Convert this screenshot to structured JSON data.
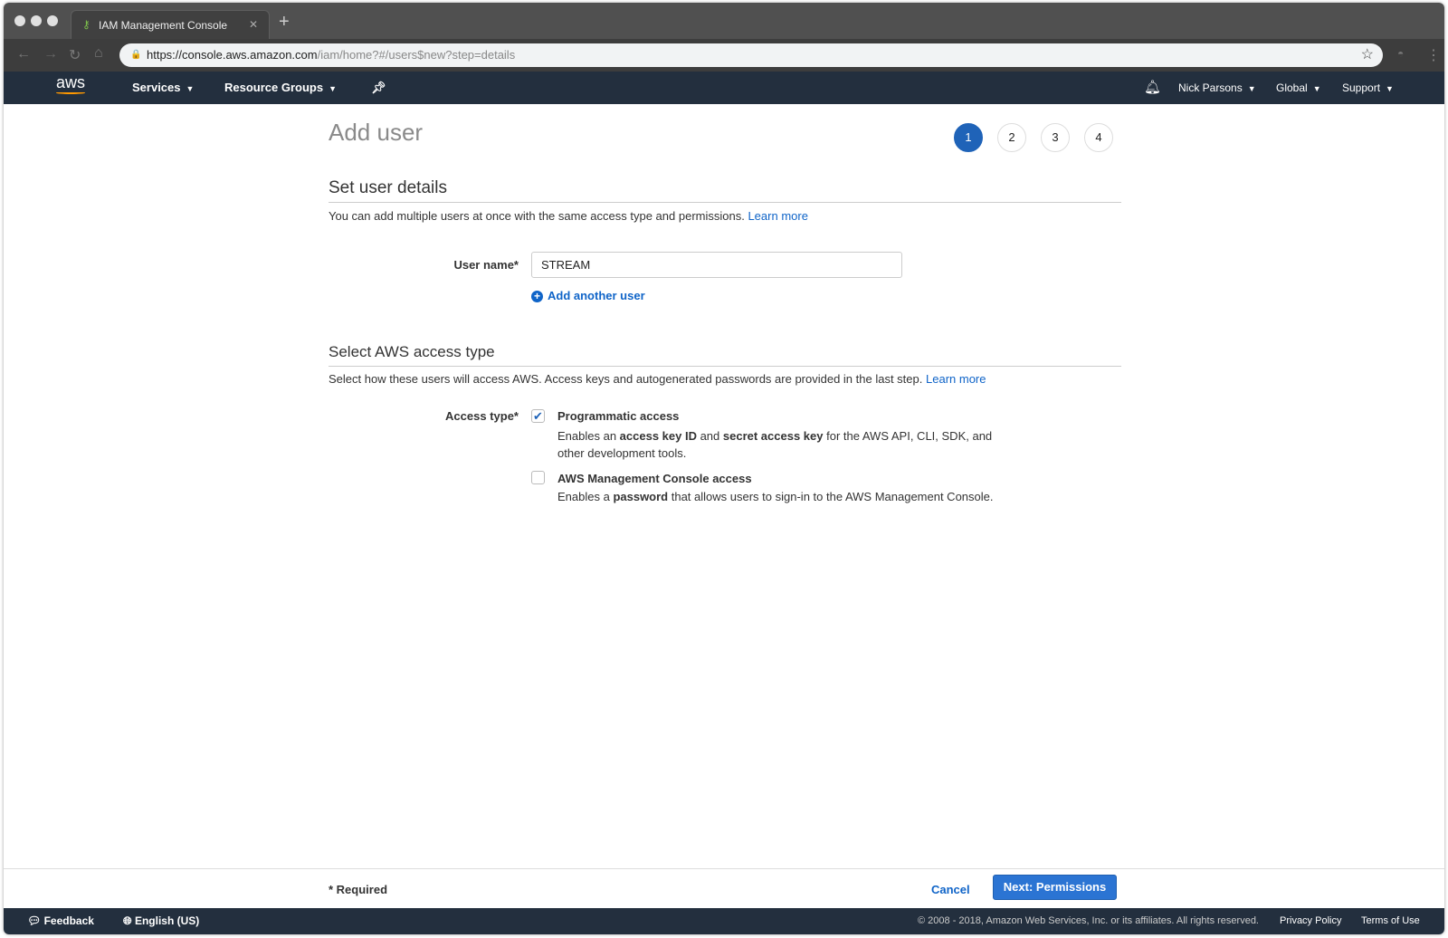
{
  "browser": {
    "tab_title": "IAM Management Console",
    "url_host": "https://console.aws.amazon.com",
    "url_path": "/iam/home?#/users$new?step=details"
  },
  "nav": {
    "logo": "aws",
    "services": "Services",
    "resource_groups": "Resource Groups",
    "user": "Nick Parsons",
    "region": "Global",
    "support": "Support"
  },
  "page": {
    "title": "Add user",
    "steps": [
      "1",
      "2",
      "3",
      "4"
    ],
    "active_step": 1
  },
  "details": {
    "heading": "Set user details",
    "description": "You can add multiple users at once with the same access type and permissions.",
    "learn_more": "Learn more",
    "user_name_label": "User name*",
    "user_name_value": "STREAM",
    "add_another": "Add another user"
  },
  "access": {
    "heading": "Select AWS access type",
    "description": "Select how these users will access AWS. Access keys and autogenerated passwords are provided in the last step.",
    "learn_more": "Learn more",
    "label": "Access type*",
    "options": [
      {
        "label": "Programmatic access",
        "checked": true,
        "d1": "Enables an ",
        "b1": "access key ID",
        "d2": " and ",
        "b2": "secret access key",
        "d3": " for the AWS API, CLI, SDK, and",
        "d4": "other development tools."
      },
      {
        "label": "AWS Management Console access",
        "checked": false,
        "d1": "Enables a ",
        "b1": "password",
        "d2": " that allows users to sign-in to the AWS Management Console."
      }
    ]
  },
  "actions": {
    "required": "* Required",
    "cancel": "Cancel",
    "next": "Next: Permissions"
  },
  "footer": {
    "feedback": "Feedback",
    "language": "English (US)",
    "copyright": "© 2008 - 2018, Amazon Web Services, Inc. or its affiliates. All rights reserved.",
    "privacy": "Privacy Policy",
    "terms": "Terms of Use"
  }
}
